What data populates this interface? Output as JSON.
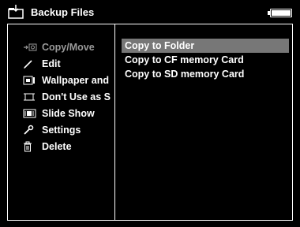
{
  "header": {
    "title": "Backup Files",
    "title_icon": "folder-icon",
    "battery_icon": "battery-icon"
  },
  "menu": {
    "items": [
      {
        "label": "Copy/Move",
        "icon": "copy-move-icon"
      },
      {
        "label": "Edit",
        "icon": "pencil-icon"
      },
      {
        "label": "Wallpaper and",
        "icon": "wallpaper-icon"
      },
      {
        "label": "Don't Use as S",
        "icon": "screen-icon"
      },
      {
        "label": "Slide Show",
        "icon": "slideshow-icon"
      },
      {
        "label": "Settings",
        "icon": "wrench-icon"
      },
      {
        "label": "Delete",
        "icon": "trash-icon"
      }
    ]
  },
  "submenu": {
    "items": [
      {
        "label": "Copy to Folder"
      },
      {
        "label": "Copy to CF memory Card"
      },
      {
        "label": "Copy to SD memory Card"
      }
    ]
  },
  "colors": {
    "background": "#000000",
    "text": "#ffffff",
    "highlight": "#777777",
    "selected_text": "#9a9a9a"
  }
}
